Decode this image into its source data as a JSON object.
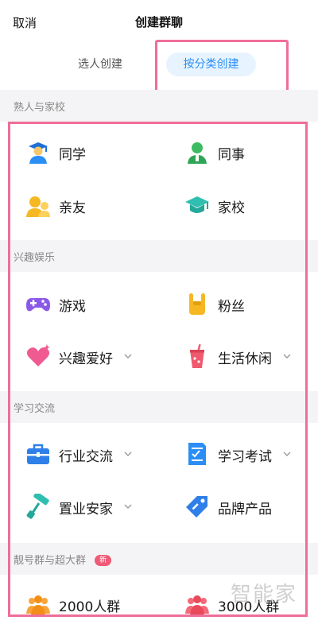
{
  "header": {
    "cancel_label": "取消",
    "title": "创建群聊"
  },
  "tabs": [
    {
      "label": "选人创建",
      "selected": false
    },
    {
      "label": "按分类创建",
      "selected": true
    }
  ],
  "sections": [
    {
      "title": "熟人与家校",
      "items": [
        {
          "label": "同学",
          "icon": "student-icon",
          "expandable": false
        },
        {
          "label": "同事",
          "icon": "coworker-icon",
          "expandable": false
        },
        {
          "label": "亲友",
          "icon": "family-icon",
          "expandable": false
        },
        {
          "label": "家校",
          "icon": "graduation-cap-icon",
          "expandable": false
        }
      ]
    },
    {
      "title": "兴趣娱乐",
      "items": [
        {
          "label": "游戏",
          "icon": "gamepad-icon",
          "expandable": false
        },
        {
          "label": "粉丝",
          "icon": "rock-hand-icon",
          "expandable": false
        },
        {
          "label": "兴趣爱好",
          "icon": "heart-icon",
          "expandable": true
        },
        {
          "label": "生活休闲",
          "icon": "drink-cup-icon",
          "expandable": true
        }
      ]
    },
    {
      "title": "学习交流",
      "items": [
        {
          "label": "行业交流",
          "icon": "briefcase-icon",
          "expandable": true
        },
        {
          "label": "学习考试",
          "icon": "exam-paper-icon",
          "expandable": true
        },
        {
          "label": "置业安家",
          "icon": "paint-roller-icon",
          "expandable": true
        },
        {
          "label": "品牌产品",
          "icon": "price-tag-icon",
          "expandable": false
        }
      ]
    },
    {
      "title": "靓号群与超大群",
      "badge": "新",
      "items": [
        {
          "label": "2000人群",
          "icon": "group-2000-icon",
          "expandable": false
        },
        {
          "label": "3000人群",
          "icon": "group-3000-icon",
          "expandable": false
        }
      ]
    }
  ],
  "watermark": "智能家",
  "colors": {
    "accent": "#2a8ef5",
    "tab_bg": "#e7f4ff",
    "highlight": "#ef6e99",
    "badge": "#ef5a76",
    "section_bg": "#f4f4f6"
  }
}
